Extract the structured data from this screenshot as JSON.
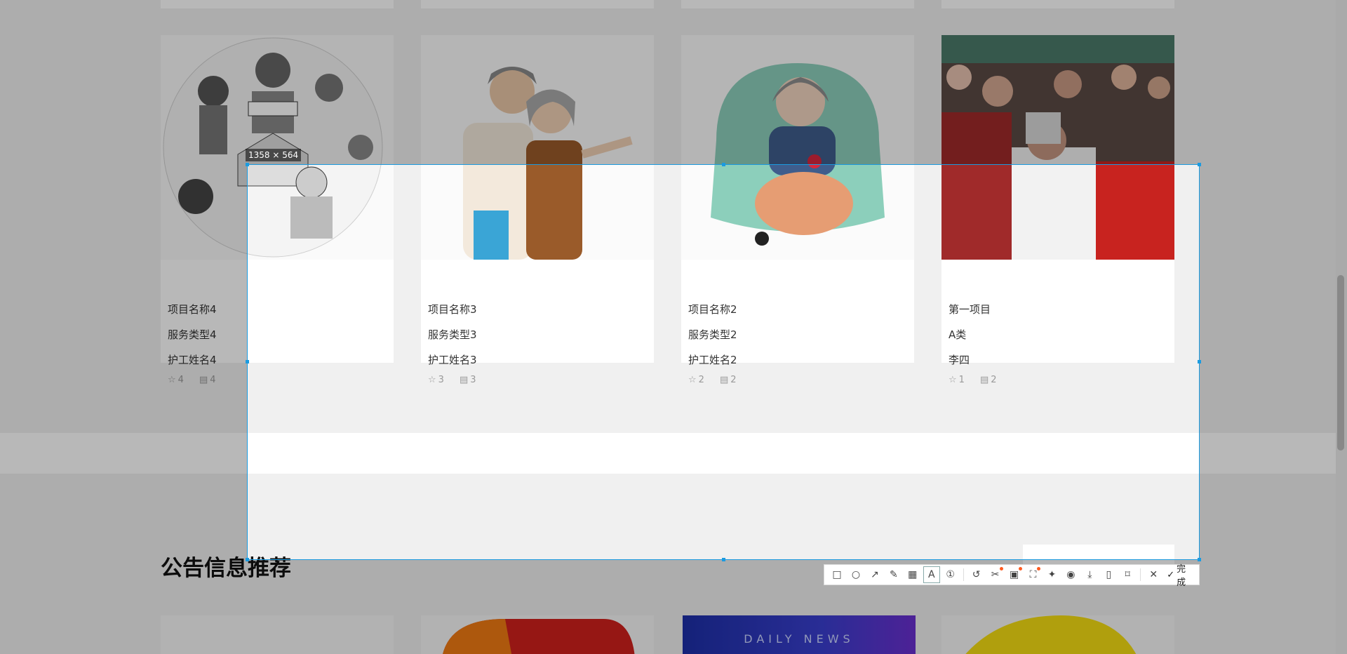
{
  "selection": {
    "size_label": "1358 × 564"
  },
  "cards": [
    {
      "name": "项目名称4",
      "type": "服务类型4",
      "nurse": "护工姓名4",
      "stars": "4",
      "comments": "4"
    },
    {
      "name": "项目名称3",
      "type": "服务类型3",
      "nurse": "护工姓名3",
      "stars": "3",
      "comments": "3"
    },
    {
      "name": "项目名称2",
      "type": "服务类型2",
      "nurse": "护工姓名2",
      "stars": "2",
      "comments": "2"
    },
    {
      "name": "第一项目",
      "type": "A类",
      "nurse": "李四",
      "stars": "1",
      "comments": "2"
    }
  ],
  "section": {
    "title": "公告信息推荐"
  },
  "bottom_cards": {
    "daily_news": "DAILY NEWS"
  },
  "toolbar": {
    "tools": [
      "rectangle-icon",
      "ellipse-icon",
      "arrow-icon",
      "pencil-icon",
      "mosaic-icon",
      "text-icon",
      "number-icon",
      "undo-icon",
      "scissors-icon",
      "translate-icon",
      "scan-icon",
      "pin-icon",
      "record-icon",
      "download-icon",
      "phone-icon",
      "bookmark-icon",
      "close-icon"
    ],
    "done_label": "完成"
  },
  "colors": {
    "selection": "#1b9be0",
    "badge": "#ff5a1f"
  }
}
